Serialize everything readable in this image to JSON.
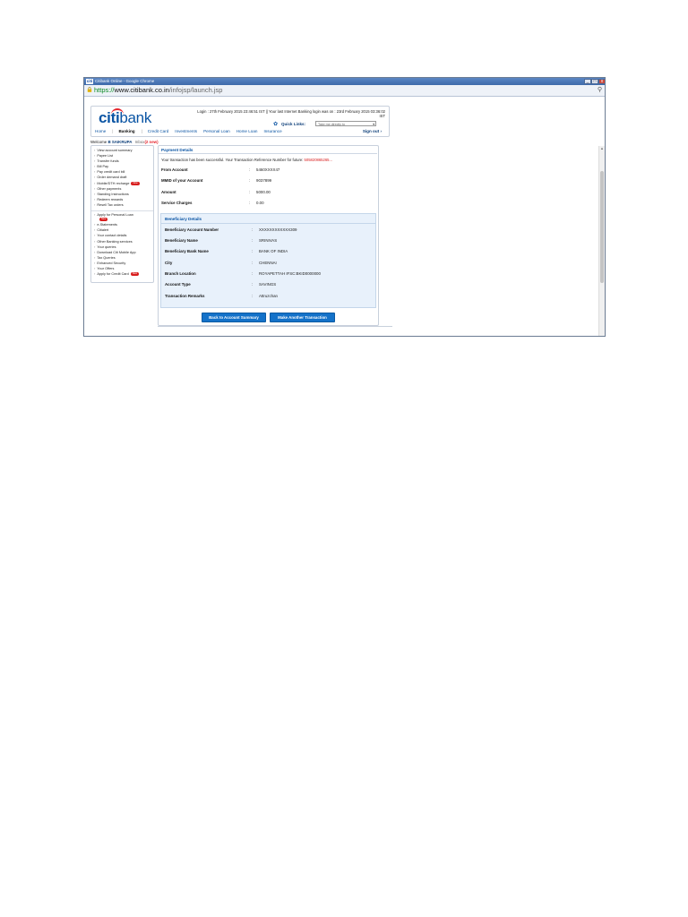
{
  "window": {
    "favicon": "citi",
    "title": "Citibank Online - Google Chrome",
    "controls": [
      "_",
      "□",
      "x"
    ]
  },
  "address": {
    "scheme": "https://",
    "host": "www.citibank.co.in",
    "path": "/infojsp/launch.jsp",
    "tools_icon": "⚲"
  },
  "header": {
    "logo_citi": "citi",
    "logo_bank": "bank",
    "login_line1": "Login : 27th February 2015 23:46:51 IST || Your last Internet Banking login was on : 23rd February 2015 03:36:02",
    "login_line2": "IST",
    "quick_links_label": "Quick Links:",
    "quick_links_placeholder": "Take me directly to",
    "nav": [
      "Home",
      "Banking",
      "Credit Card",
      "Investments",
      "Personal Loan",
      "Home Loan",
      "Insurance"
    ],
    "active_nav": "Banking",
    "sign_out": "Sign out ›"
  },
  "welcome": {
    "prefix": "Welcome",
    "name": "B SAIKRUPA",
    "inbox": "Inbox",
    "mail_count": "(2 new)"
  },
  "menu": {
    "group1": [
      "View account summary",
      "Payee List",
      "Transfer funds",
      "Bill Pay",
      "Pay credit card bill",
      "Order demand draft",
      "Mobile/DTH recharge",
      "Other payments",
      "Standing Instructions",
      "Redeem rewards",
      "Resell Tax orders"
    ],
    "group2": [
      "Apply for Personal Loan",
      "e-Statements",
      "Citialert",
      "Your contact details",
      "Other Banking services",
      "Your queries",
      "Download Citi Mobile App",
      "Tax Queries",
      "Enhanced Security",
      "Your Offers",
      "Apply for Credit Card"
    ],
    "badge": "New"
  },
  "payment": {
    "title": "Payment Details",
    "success_text": "Your transaction has been successful. Your Transaction Reference Number for future:",
    "reference": "505820865265...",
    "rows": [
      {
        "label": "From Account",
        "value": "5460XXXX47"
      },
      {
        "label": "MMID of your Account",
        "value": "9037899"
      },
      {
        "label": "Amount",
        "value": "5000.00"
      },
      {
        "label": "Service Charges",
        "value": "0.00"
      }
    ]
  },
  "beneficiary": {
    "title": "Beneficiary Details",
    "rows": [
      {
        "label": "Beneficiary Account Number",
        "value": "XXXXXXXXXXXX309"
      },
      {
        "label": "Beneficiary Name",
        "value": "SRINIVAS"
      },
      {
        "label": "Beneficiary Bank Name",
        "value": "BANK OF INDIA"
      },
      {
        "label": "City",
        "value": "CHENNAI"
      },
      {
        "label": "Branch Location",
        "value": "ROYAPETTAH IFSC:BKID0000000"
      },
      {
        "label": "Account Type",
        "value": "SAVINGS"
      },
      {
        "label": "Transaction Remarks",
        "value": "Attruzchan"
      }
    ]
  },
  "buttons": {
    "back": "Back to Account Summary",
    "another": "Make Another Transaction"
  },
  "colon": ":"
}
